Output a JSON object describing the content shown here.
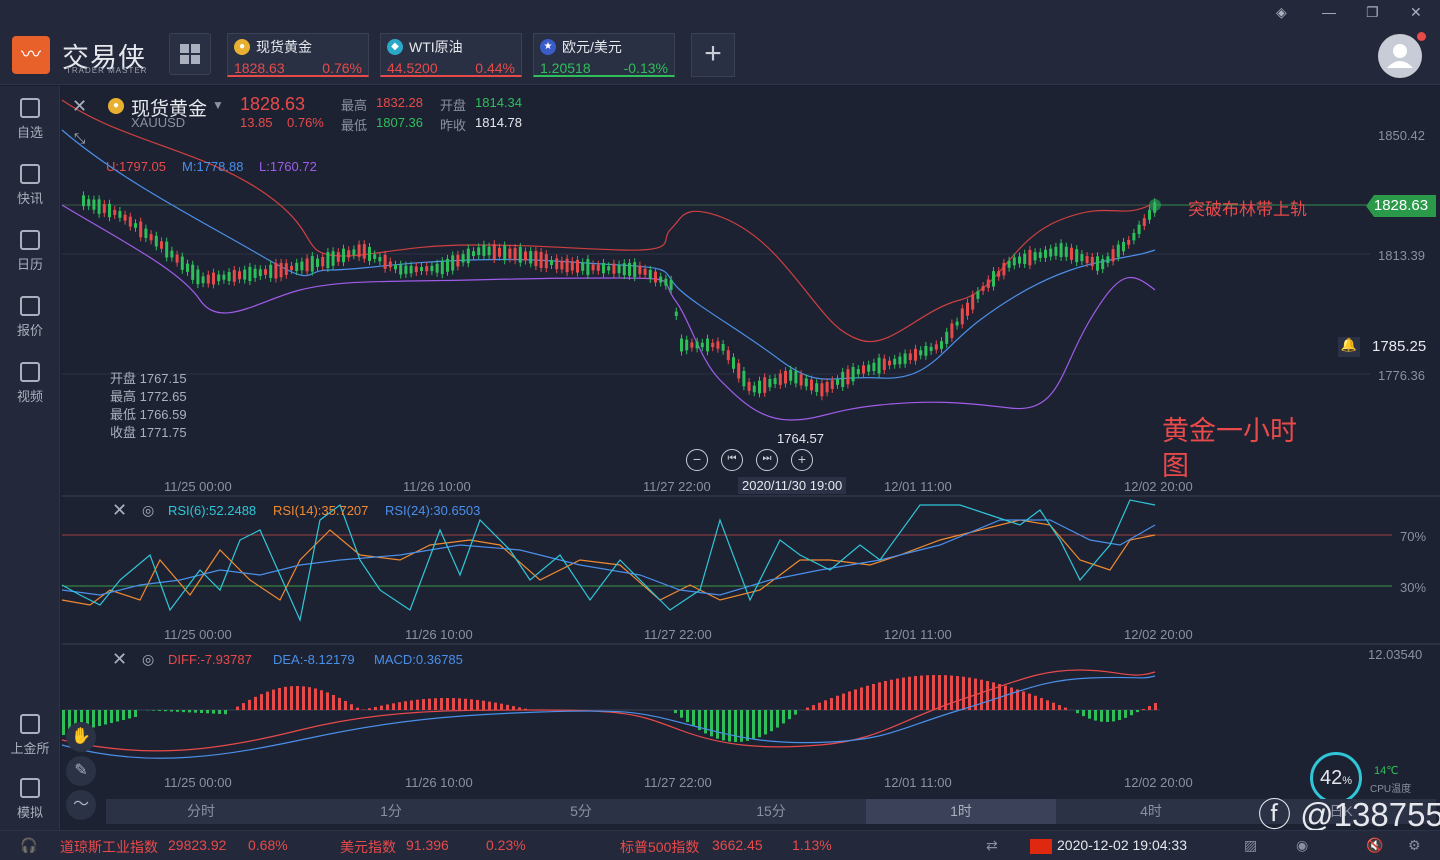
{
  "app": {
    "name": "交易侠",
    "sub": "TRADER MASTER"
  },
  "quote_tabs": [
    {
      "name": "现货黄金",
      "price": "1828.63",
      "change": "0.76%",
      "icon": "gold-icon"
    },
    {
      "name": "WTI原油",
      "price": "44.5200",
      "change": "0.44%",
      "icon": "oil-icon"
    },
    {
      "name": "欧元/美元",
      "price": "1.20518",
      "change": "-0.13%",
      "icon": "eu-us-flag-icon"
    }
  ],
  "sidebar": [
    {
      "label": "自选",
      "icon": "bookmark-icon"
    },
    {
      "label": "快讯",
      "icon": "news-icon"
    },
    {
      "label": "日历",
      "icon": "calendar-icon"
    },
    {
      "label": "报价",
      "icon": "quote-chart-icon"
    },
    {
      "label": "视频",
      "icon": "video-icon"
    },
    {
      "label": "上金所",
      "icon": "sge-icon"
    },
    {
      "label": "模拟",
      "icon": "simulate-icon"
    }
  ],
  "symbol": {
    "name": "现货黄金",
    "code": "XAUUSD",
    "price": "1828.63",
    "change": "13.85",
    "change_pct": "0.76%",
    "high_label": "最高",
    "high": "1832.28",
    "open_label": "开盘",
    "open": "1814.34",
    "low_label": "最低",
    "low": "1807.36",
    "prev_label": "昨收",
    "prev": "1814.78"
  },
  "boll": {
    "u": "U:1797.05",
    "m": "M:1778.88",
    "l": "L:1760.72"
  },
  "ohlc_box": {
    "open": "开盘 1767.15",
    "high": "最高 1772.65",
    "low": "最低 1766.59",
    "close": "收盘 1771.75"
  },
  "price_axis": [
    "1850.42",
    "1813.39",
    "1776.36"
  ],
  "current_price": "1828.63",
  "alert_price": "1785.25",
  "low_marker": "1764.57",
  "annotation_break": "突破布林带上轨",
  "annotation_title1": "黄金一小时",
  "annotation_title2": "图",
  "time_axis": [
    "11/25 00:00",
    "11/26 10:00",
    "11/27 22:00",
    "12/01 11:00",
    "12/02 20:00"
  ],
  "crosshair_time": "2020/11/30 19:00",
  "rsi": {
    "r6": "RSI(6):52.2488",
    "r14": "RSI(14):35.7207",
    "r24": "RSI(24):30.6503",
    "lv70": "70%",
    "lv30": "30%"
  },
  "macd": {
    "diff": "DIFF:-7.93787",
    "dea": "DEA:-8.12179",
    "macd": "MACD:0.36785",
    "top": "12.03540"
  },
  "periods": [
    "分时",
    "1分",
    "5分",
    "15分",
    "1时",
    "4时",
    "日K"
  ],
  "active_period": "1时",
  "cpu": {
    "pct": "42",
    "unit": "%",
    "temp": "14℃",
    "label": "CPU温度"
  },
  "ticker": [
    {
      "name": "道琼斯工业指数",
      "value": "29823.92",
      "pct": "0.68%"
    },
    {
      "name": "美元指数",
      "value": "91.396",
      "pct": "0.23%"
    },
    {
      "name": "标普500指数",
      "value": "3662.45",
      "pct": "1.13%"
    }
  ],
  "clock": "2020-12-02 19:04:33",
  "watermark": "@138755",
  "colors": {
    "up": "#e84a4a",
    "down": "#2fbf5a",
    "bg": "#1d2233"
  }
}
